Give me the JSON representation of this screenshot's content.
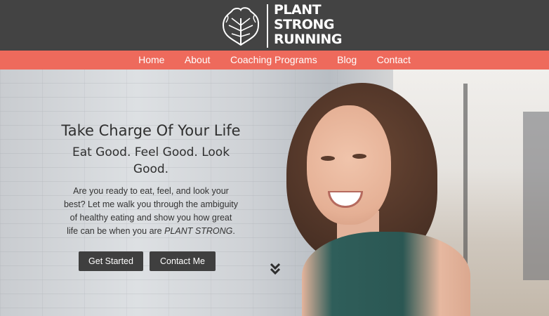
{
  "header": {
    "logo_lines": [
      "PLANT",
      "STRONG",
      "RUNNING"
    ],
    "logo_icon": "leaf-icon"
  },
  "nav": {
    "items": [
      {
        "label": "Home"
      },
      {
        "label": "About"
      },
      {
        "label": "Coaching Programs"
      },
      {
        "label": "Blog"
      },
      {
        "label": "Contact"
      }
    ],
    "bg_color": "#ee6a5c"
  },
  "hero": {
    "headline": "Take Charge Of Your Life",
    "subhead": "Eat Good. Feel Good. Look Good.",
    "para_main": "Are you ready to eat, feel, and look your best? Let me walk you through the ambiguity of healthy eating and show you how great life can be when you are",
    "para_em": "PLANT STRONG",
    "para_end": ".",
    "buttons": [
      {
        "label": "Get Started"
      },
      {
        "label": "Contact Me"
      }
    ],
    "scroll_icon": "double-chevron-down-icon"
  }
}
